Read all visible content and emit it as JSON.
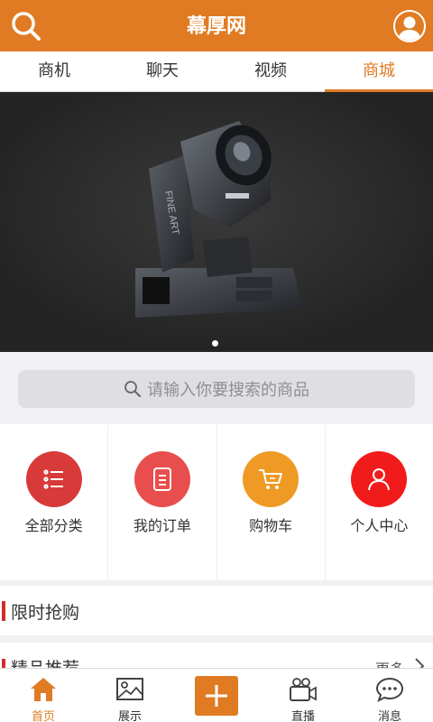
{
  "header": {
    "title": "幕厚网",
    "search_icon": "search-icon",
    "avatar_icon": "user-icon"
  },
  "tabs": [
    {
      "label": "商机",
      "active": false
    },
    {
      "label": "聊天",
      "active": false
    },
    {
      "label": "视频",
      "active": false
    },
    {
      "label": "商城",
      "active": true
    }
  ],
  "banner": {
    "image_label": "FINE ART",
    "page_index": 1,
    "page_count": 1
  },
  "search": {
    "placeholder": "请输入你要搜索的商品"
  },
  "quick_actions": [
    {
      "label": "全部分类",
      "icon": "list-icon",
      "color": "#d83a3a"
    },
    {
      "label": "我的订单",
      "icon": "order-icon",
      "color": "#e84e4e"
    },
    {
      "label": "购物车",
      "icon": "cart-icon",
      "color": "#ee9a24"
    },
    {
      "label": "个人中心",
      "icon": "person-icon",
      "color": "#f21b1b"
    }
  ],
  "sections": {
    "flash_sale": {
      "label": "限时抢购"
    },
    "recommend": {
      "label": "精品推荐",
      "more": "更多"
    }
  },
  "bottom_nav": [
    {
      "label": "首页",
      "icon": "home-icon",
      "active": true
    },
    {
      "label": "展示",
      "icon": "image-icon",
      "active": false
    },
    {
      "label": "",
      "icon": "plus-icon",
      "active": false
    },
    {
      "label": "直播",
      "icon": "video-camera-icon",
      "active": false
    },
    {
      "label": "消息",
      "icon": "chat-icon",
      "active": false
    }
  ],
  "colors": {
    "brand": "#e07b23",
    "accent_red": "#d32b2b"
  }
}
